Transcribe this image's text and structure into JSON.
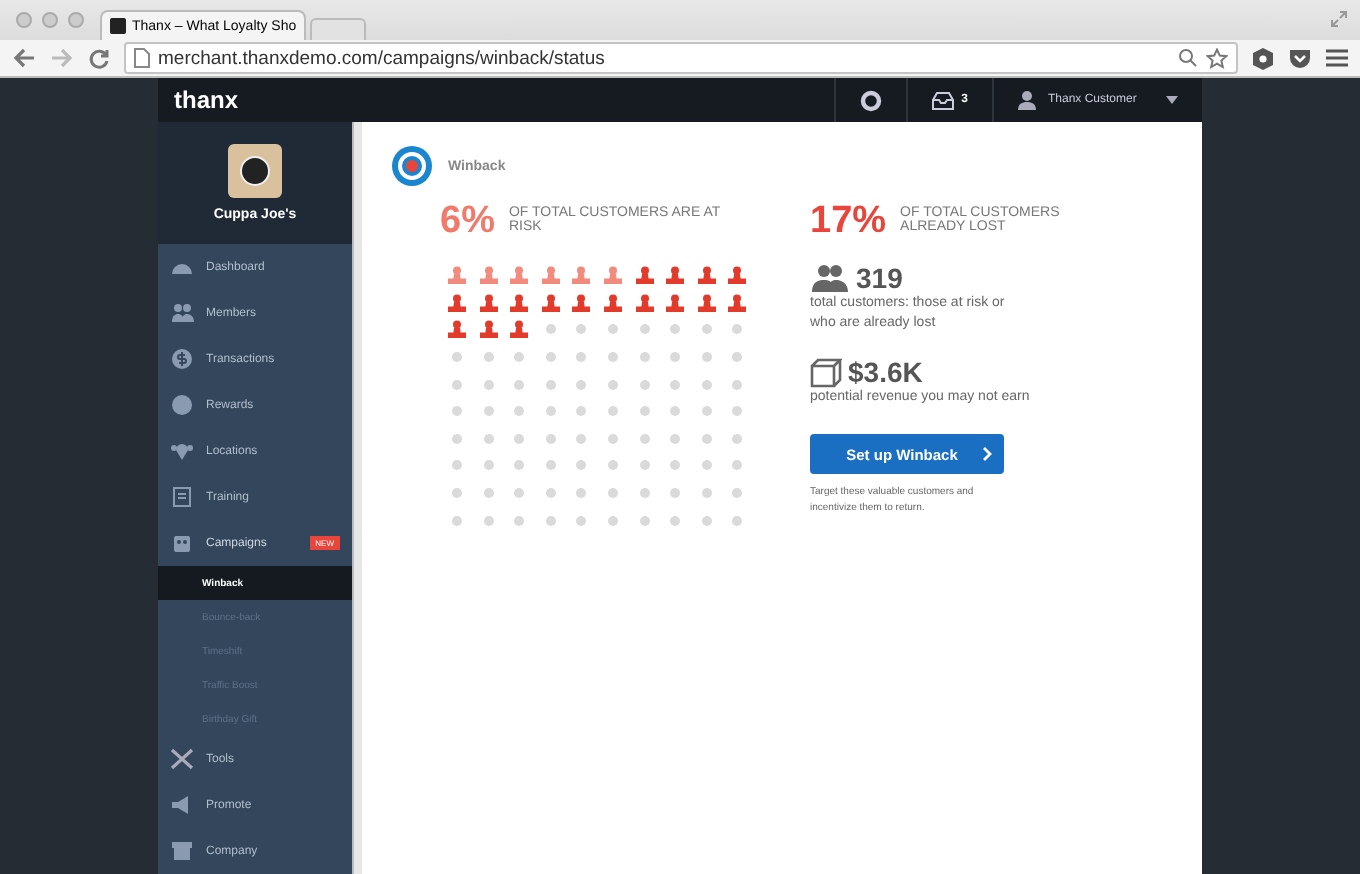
{
  "browser": {
    "tab_title": "Thanx – What Loyalty Sho",
    "url": "merchant.thanxdemo.com/campaigns/winback/status"
  },
  "topbar": {
    "logo": "thanx",
    "inbox_count": "3",
    "user_name": "Thanx Customer"
  },
  "sidebar": {
    "merchant_name": "Cuppa Joe's",
    "items": [
      {
        "label": "Dashboard",
        "kind": "dashboard"
      },
      {
        "label": "Members",
        "kind": "members"
      },
      {
        "label": "Transactions",
        "kind": "transactions"
      },
      {
        "label": "Rewards",
        "kind": "rewards"
      },
      {
        "label": "Locations",
        "kind": "locations"
      },
      {
        "label": "Training",
        "kind": "training"
      },
      {
        "label": "Campaigns",
        "kind": "campaigns",
        "badge": "NEW",
        "expanded": true,
        "children": [
          {
            "label": "Winback",
            "selected": true
          },
          {
            "label": "Bounce-back",
            "selected": false
          },
          {
            "label": "Timeshift",
            "selected": false
          },
          {
            "label": "Traffic Boost",
            "selected": false
          },
          {
            "label": "Birthday Gift",
            "selected": false
          }
        ]
      },
      {
        "label": "Tools",
        "kind": "tools"
      },
      {
        "label": "Promote",
        "kind": "promote"
      },
      {
        "label": "Company",
        "kind": "company"
      }
    ]
  },
  "page": {
    "title": "Winback",
    "at_risk": {
      "percent": "6%",
      "caption": "OF TOTAL CUSTOMERS ARE AT RISK"
    },
    "lost": {
      "percent": "17%",
      "caption": "OF TOTAL CUSTOMERS ALREADY LOST"
    },
    "grid": [
      [
        {
          "kind": "at_risk"
        },
        {
          "kind": "at_risk"
        },
        {
          "kind": "at_risk"
        },
        {
          "kind": "at_risk"
        },
        {
          "kind": "at_risk"
        },
        {
          "kind": "at_risk"
        },
        {
          "kind": "lost"
        },
        {
          "kind": "lost"
        },
        {
          "kind": "lost"
        },
        {
          "kind": "lost"
        }
      ],
      [
        {
          "kind": "lost"
        },
        {
          "kind": "lost"
        },
        {
          "kind": "lost"
        },
        {
          "kind": "lost"
        },
        {
          "kind": "lost"
        },
        {
          "kind": "lost"
        },
        {
          "kind": "lost"
        },
        {
          "kind": "lost"
        },
        {
          "kind": "lost"
        },
        {
          "kind": "lost"
        }
      ],
      [
        {
          "kind": "lost"
        },
        {
          "kind": "lost"
        },
        {
          "kind": "lost"
        },
        {
          "kind": "none"
        },
        {
          "kind": "none"
        },
        {
          "kind": "none"
        },
        {
          "kind": "none"
        },
        {
          "kind": "none"
        },
        {
          "kind": "none"
        },
        {
          "kind": "none"
        }
      ],
      [
        {
          "kind": "none"
        },
        {
          "kind": "none"
        },
        {
          "kind": "none"
        },
        {
          "kind": "none"
        },
        {
          "kind": "none"
        },
        {
          "kind": "none"
        },
        {
          "kind": "none"
        },
        {
          "kind": "none"
        },
        {
          "kind": "none"
        },
        {
          "kind": "none"
        }
      ],
      [
        {
          "kind": "none"
        },
        {
          "kind": "none"
        },
        {
          "kind": "none"
        },
        {
          "kind": "none"
        },
        {
          "kind": "none"
        },
        {
          "kind": "none"
        },
        {
          "kind": "none"
        },
        {
          "kind": "none"
        },
        {
          "kind": "none"
        },
        {
          "kind": "none"
        }
      ],
      [
        {
          "kind": "none"
        },
        {
          "kind": "none"
        },
        {
          "kind": "none"
        },
        {
          "kind": "none"
        },
        {
          "kind": "none"
        },
        {
          "kind": "none"
        },
        {
          "kind": "none"
        },
        {
          "kind": "none"
        },
        {
          "kind": "none"
        },
        {
          "kind": "none"
        }
      ],
      [
        {
          "kind": "none"
        },
        {
          "kind": "none"
        },
        {
          "kind": "none"
        },
        {
          "kind": "none"
        },
        {
          "kind": "none"
        },
        {
          "kind": "none"
        },
        {
          "kind": "none"
        },
        {
          "kind": "none"
        },
        {
          "kind": "none"
        },
        {
          "kind": "none"
        }
      ],
      [
        {
          "kind": "none"
        },
        {
          "kind": "none"
        },
        {
          "kind": "none"
        },
        {
          "kind": "none"
        },
        {
          "kind": "none"
        },
        {
          "kind": "none"
        },
        {
          "kind": "none"
        },
        {
          "kind": "none"
        },
        {
          "kind": "none"
        },
        {
          "kind": "none"
        }
      ],
      [
        {
          "kind": "none"
        },
        {
          "kind": "none"
        },
        {
          "kind": "none"
        },
        {
          "kind": "none"
        },
        {
          "kind": "none"
        },
        {
          "kind": "none"
        },
        {
          "kind": "none"
        },
        {
          "kind": "none"
        },
        {
          "kind": "none"
        },
        {
          "kind": "none"
        }
      ],
      [
        {
          "kind": "none"
        },
        {
          "kind": "none"
        },
        {
          "kind": "none"
        },
        {
          "kind": "none"
        },
        {
          "kind": "none"
        },
        {
          "kind": "none"
        },
        {
          "kind": "none"
        },
        {
          "kind": "none"
        },
        {
          "kind": "none"
        },
        {
          "kind": "none"
        }
      ]
    ],
    "total_customers": {
      "value": "319",
      "caption": "total customers: those at risk or who are already lost"
    },
    "revenue": {
      "value": "$3.6K",
      "caption": "potential revenue you may not earn"
    },
    "button": "Set up Winback",
    "button_note": "Target these valuable customers and incentivize them to return."
  }
}
